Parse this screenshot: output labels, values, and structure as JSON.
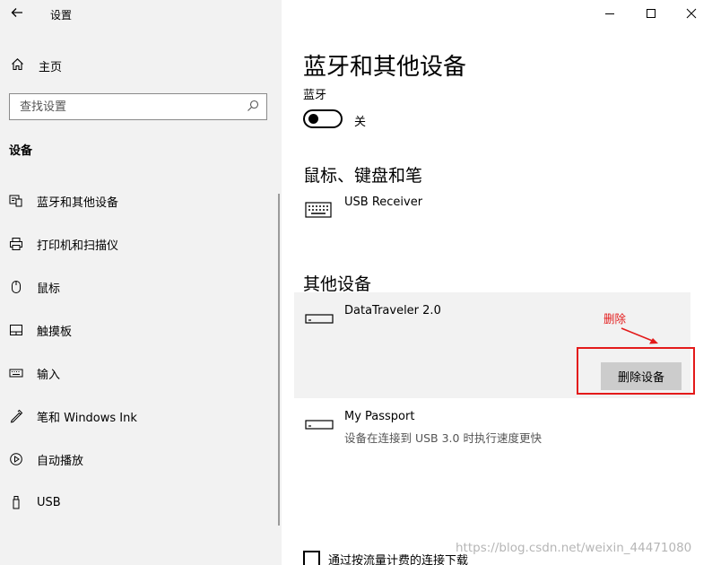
{
  "window": {
    "title": "设置",
    "back_icon": "back-arrow-icon",
    "controls": [
      "minimize-icon",
      "maximize-icon",
      "close-icon"
    ]
  },
  "sidebar": {
    "home_label": "主页",
    "search_placeholder": "查找设置",
    "section_heading": "设备",
    "items": [
      {
        "label": "蓝牙和其他设备",
        "icon": "bluetooth-devices-icon"
      },
      {
        "label": "打印机和扫描仪",
        "icon": "printer-icon"
      },
      {
        "label": "鼠标",
        "icon": "mouse-icon"
      },
      {
        "label": "触摸板",
        "icon": "touchpad-icon"
      },
      {
        "label": "输入",
        "icon": "keyboard-icon"
      },
      {
        "label": "笔和 Windows Ink",
        "icon": "pen-icon"
      },
      {
        "label": "自动播放",
        "icon": "autoplay-icon"
      },
      {
        "label": "USB",
        "icon": "usb-icon"
      }
    ]
  },
  "main": {
    "title": "蓝牙和其他设备",
    "bluetooth_label": "蓝牙",
    "bluetooth_state": "关",
    "mouse_section": "鼠标、键盘和笔",
    "other_section": "其他设备",
    "devices": {
      "usb_receiver": {
        "name": "USB Receiver"
      },
      "datatraveler": {
        "name": "DataTraveler 2.0",
        "remove_label": "删除设备"
      },
      "my_passport": {
        "name": "My Passport",
        "status": "设备在连接到 USB 3.0 时执行速度更快"
      }
    },
    "metered_label": "通过按流量计费的连接下载"
  },
  "annotation": {
    "label": "删除",
    "color": "#e31a1a"
  },
  "watermark": "https://blog.csdn.net/weixin_44471080"
}
